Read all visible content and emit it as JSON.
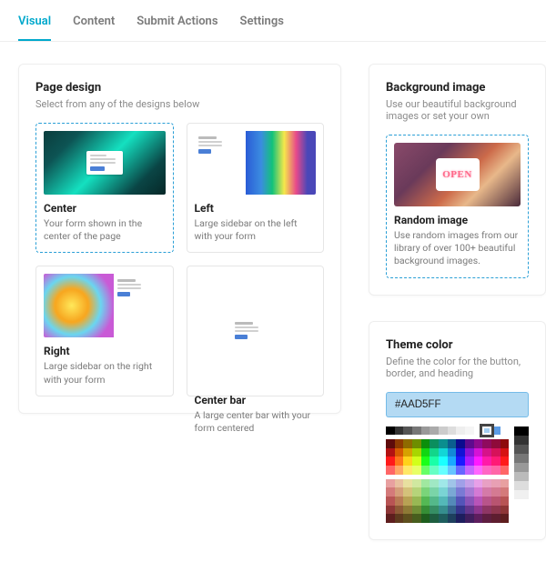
{
  "tabs": [
    {
      "label": "Visual",
      "active": true
    },
    {
      "label": "Content",
      "active": false
    },
    {
      "label": "Submit Actions",
      "active": false
    },
    {
      "label": "Settings",
      "active": false
    }
  ],
  "page_design": {
    "title": "Page design",
    "subtitle": "Select from any of the designs below",
    "options": [
      {
        "name": "Center",
        "desc": "Your form shown in the center of the page",
        "selected": true
      },
      {
        "name": "Left",
        "desc": "Large sidebar on the left with your form",
        "selected": false
      },
      {
        "name": "Right",
        "desc": "Large sidebar on the right with your form",
        "selected": false
      },
      {
        "name": "Center bar",
        "desc": "A large center bar with your form centered",
        "selected": false
      }
    ]
  },
  "background_image": {
    "title": "Background image",
    "subtitle": "Use our beautiful background images or set your own",
    "option": {
      "name": "Random image",
      "desc": "Use random images from our library of over 100+ beautiful background images.",
      "sign": "OPEN"
    }
  },
  "theme_color": {
    "title": "Theme color",
    "subtitle": "Define the color for the button, border, and heading",
    "value": "#AAD5FF",
    "selected_index": 2,
    "row1": [
      "#000000",
      "#333333",
      "#555555",
      "#777777",
      "#999999",
      "#aaaaaa",
      "#cccccc",
      "#dddddd",
      "#eeeeee",
      "#f5f5f5",
      "#ffffff",
      "#a3cef1",
      "#5c9ce6",
      "#ffffff"
    ],
    "main_rows": [
      [
        "#5e0b0b",
        "#8e3a00",
        "#8e6a00",
        "#6e8e00",
        "#0b8e0b",
        "#0b8e5e",
        "#0b8e8e",
        "#0b5e8e",
        "#0b0b8e",
        "#5e0b8e",
        "#8e0b8e",
        "#8e0b5e",
        "#8e0b3a",
        "#8e0b0b"
      ],
      [
        "#b21212",
        "#d65a00",
        "#d6a200",
        "#a8d600",
        "#12d612",
        "#12d68a",
        "#12d6d6",
        "#128ad6",
        "#1212d6",
        "#8a12d6",
        "#d612d6",
        "#d6128a",
        "#d6125a",
        "#d61212"
      ],
      [
        "#ff1a1a",
        "#ff761a",
        "#ffd21a",
        "#d2ff1a",
        "#1aff1a",
        "#1affa8",
        "#1affff",
        "#1aa8ff",
        "#1a1aff",
        "#a81aff",
        "#ff1aff",
        "#ff1aa8",
        "#ff1a76",
        "#ff1a1a"
      ],
      [
        "#ff6666",
        "#ffa866",
        "#ffe866",
        "#e8ff66",
        "#66ff66",
        "#66ffc4",
        "#66ffff",
        "#66c4ff",
        "#6666ff",
        "#c466ff",
        "#ff66ff",
        "#ff66c4",
        "#ff66a8",
        "#ff6666"
      ]
    ],
    "pastel_rows": [
      [
        "#e8a0a0",
        "#e8c0a0",
        "#e8e0a0",
        "#d0e8a0",
        "#a0e8a0",
        "#a0e8c4",
        "#a0e8e8",
        "#a0c4e8",
        "#a0a0e8",
        "#c4a0e8",
        "#e8a0e8",
        "#e8a0c4",
        "#e8a0b4",
        "#e8a0a0"
      ],
      [
        "#d47a7a",
        "#d49e7a",
        "#d4c27a",
        "#b6d47a",
        "#7ad47a",
        "#7ad4a8",
        "#7ad4d4",
        "#7aa8d4",
        "#7a7ad4",
        "#a87ad4",
        "#d47ad4",
        "#d47aa8",
        "#d47a92",
        "#d47a7a"
      ],
      [
        "#b85454",
        "#b87a54",
        "#b8a254",
        "#98b854",
        "#54b854",
        "#54b88a",
        "#54b8b8",
        "#548ab8",
        "#5454b8",
        "#8a54b8",
        "#b854b8",
        "#b8548a",
        "#b85470",
        "#b85454"
      ],
      [
        "#8e3636",
        "#8e5a36",
        "#8e7a36",
        "#708e36",
        "#368e36",
        "#368e64",
        "#368e8e",
        "#36648e",
        "#36368e",
        "#64368e",
        "#8e368e",
        "#8e3664",
        "#8e364e",
        "#8e3636"
      ],
      [
        "#5e1e1e",
        "#5e3a1e",
        "#5e501e",
        "#485e1e",
        "#1e5e1e",
        "#1e5e40",
        "#1e5e5e",
        "#1e405e",
        "#1e1e5e",
        "#401e5e",
        "#5e1e5e",
        "#5e1e40",
        "#5e1e30",
        "#5e1e1e"
      ]
    ],
    "grays": [
      "#000000",
      "#333333",
      "#555555",
      "#777777",
      "#999999",
      "#bbbbbb",
      "#dddddd",
      "#f0f0f0",
      "#ffffff"
    ]
  }
}
